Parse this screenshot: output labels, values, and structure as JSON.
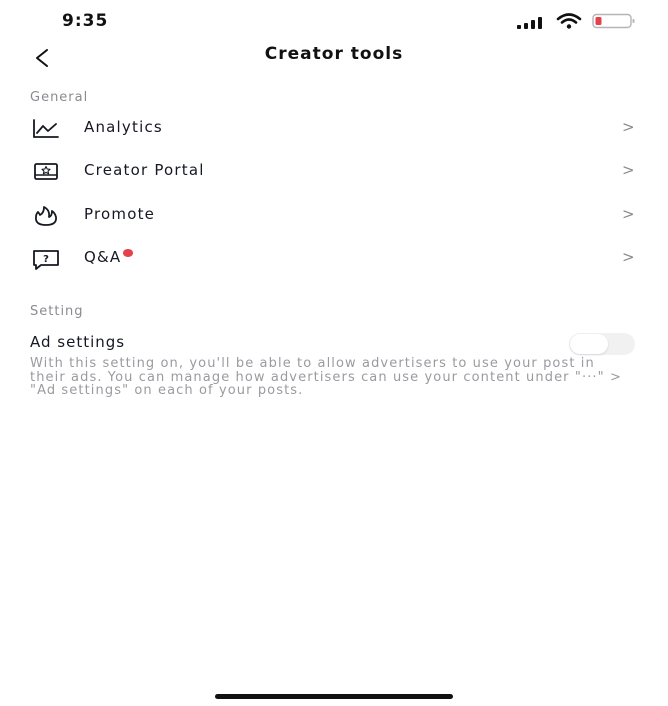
{
  "status_bar": {
    "time": "9:35",
    "icons": [
      "signal-icon",
      "wifi-icon",
      "battery-icon"
    ],
    "battery_low_color": "#e5404b"
  },
  "header": {
    "title": "Creator tools",
    "back_icon": "back-chevron-icon"
  },
  "general_section": {
    "label": "General",
    "items": [
      {
        "label": "Analytics",
        "icon": "analytics-icon",
        "chevron": ">"
      },
      {
        "label": "Creator Portal",
        "icon": "creator-portal-icon",
        "chevron": ">"
      },
      {
        "label": "Promote",
        "icon": "promote-flame-icon",
        "chevron": ">"
      },
      {
        "label": "Q&A",
        "icon": "qa-icon",
        "chevron": ">",
        "has_notification_dot": true
      }
    ]
  },
  "setting_section": {
    "label": "Setting",
    "ad_settings": {
      "title": "Ad settings",
      "enabled": false,
      "description": "With this setting on, you'll be able to allow advertisers to use your post in their ads. You can manage how advertisers can use your content under \"···\" > \"Ad settings\" on each of your posts."
    }
  },
  "colors": {
    "text_primary": "#161823",
    "text_secondary": "#8a8b91",
    "notification_dot": "#e5404b",
    "toggle_off": "#f1f1f2"
  }
}
